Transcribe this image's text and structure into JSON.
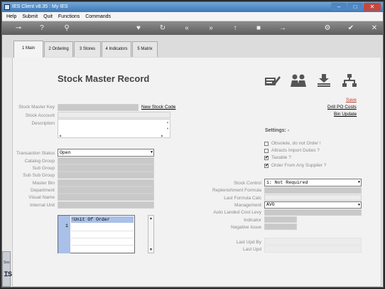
{
  "window": {
    "title": "IES Client v8.35 : My IES"
  },
  "menu": [
    "Help",
    "Submit",
    "Quit",
    "Functions",
    "Commands"
  ],
  "tabs": [
    "1 Main",
    "2 Ordering",
    "3 Stores",
    "4 Indicators",
    "5 Matrix"
  ],
  "page_title": "Stock Master Record",
  "links": {
    "new_stock_code": "New Stock Code",
    "save": "Save",
    "drill_po_costs": "Drill PO Costs",
    "bin_update": "Bin Update"
  },
  "labels": {
    "stock_master_key": "Stock Master Key",
    "stock_account": "Stock Account",
    "description": "Description",
    "transaction_status": "Transaction Status",
    "catalog_group": "Catalog Group",
    "sub_group": "Sub Group",
    "sub_sub_group": "Sub Sub Group",
    "master_bin": "Master Bin",
    "department": "Department",
    "visual_name": "Visual Name",
    "internal_unit": "Internal Unit",
    "settings": "Settings: -",
    "stock_control": "Stock Control",
    "replenishment_formula": "Replenishment Formula",
    "last_formula_calc": "Last Formula Calc",
    "management": "Management",
    "auto_landed_cost_levy": "Auto Landed Cost Levy",
    "indicator": "Indicator",
    "negative_issue": "Negative Issue",
    "last_upd_by": "Last Upd By",
    "last_upd": "Last Upd"
  },
  "values": {
    "transaction_status": "Open",
    "stock_control": "1: Not Required",
    "management": "AVG"
  },
  "checkboxes": [
    {
      "label": "Obsolete, do not Order !",
      "checked": false
    },
    {
      "label": "Attracts Import Duties ?",
      "checked": false
    },
    {
      "label": "Taxable ?",
      "checked": true
    },
    {
      "label": "Order From Any Supplier ?",
      "checked": true
    }
  ],
  "unit_grid": {
    "header": "!Unit Of Order",
    "row_number": "1"
  },
  "check_mark": "✔",
  "left_strip_text": "Ses"
}
